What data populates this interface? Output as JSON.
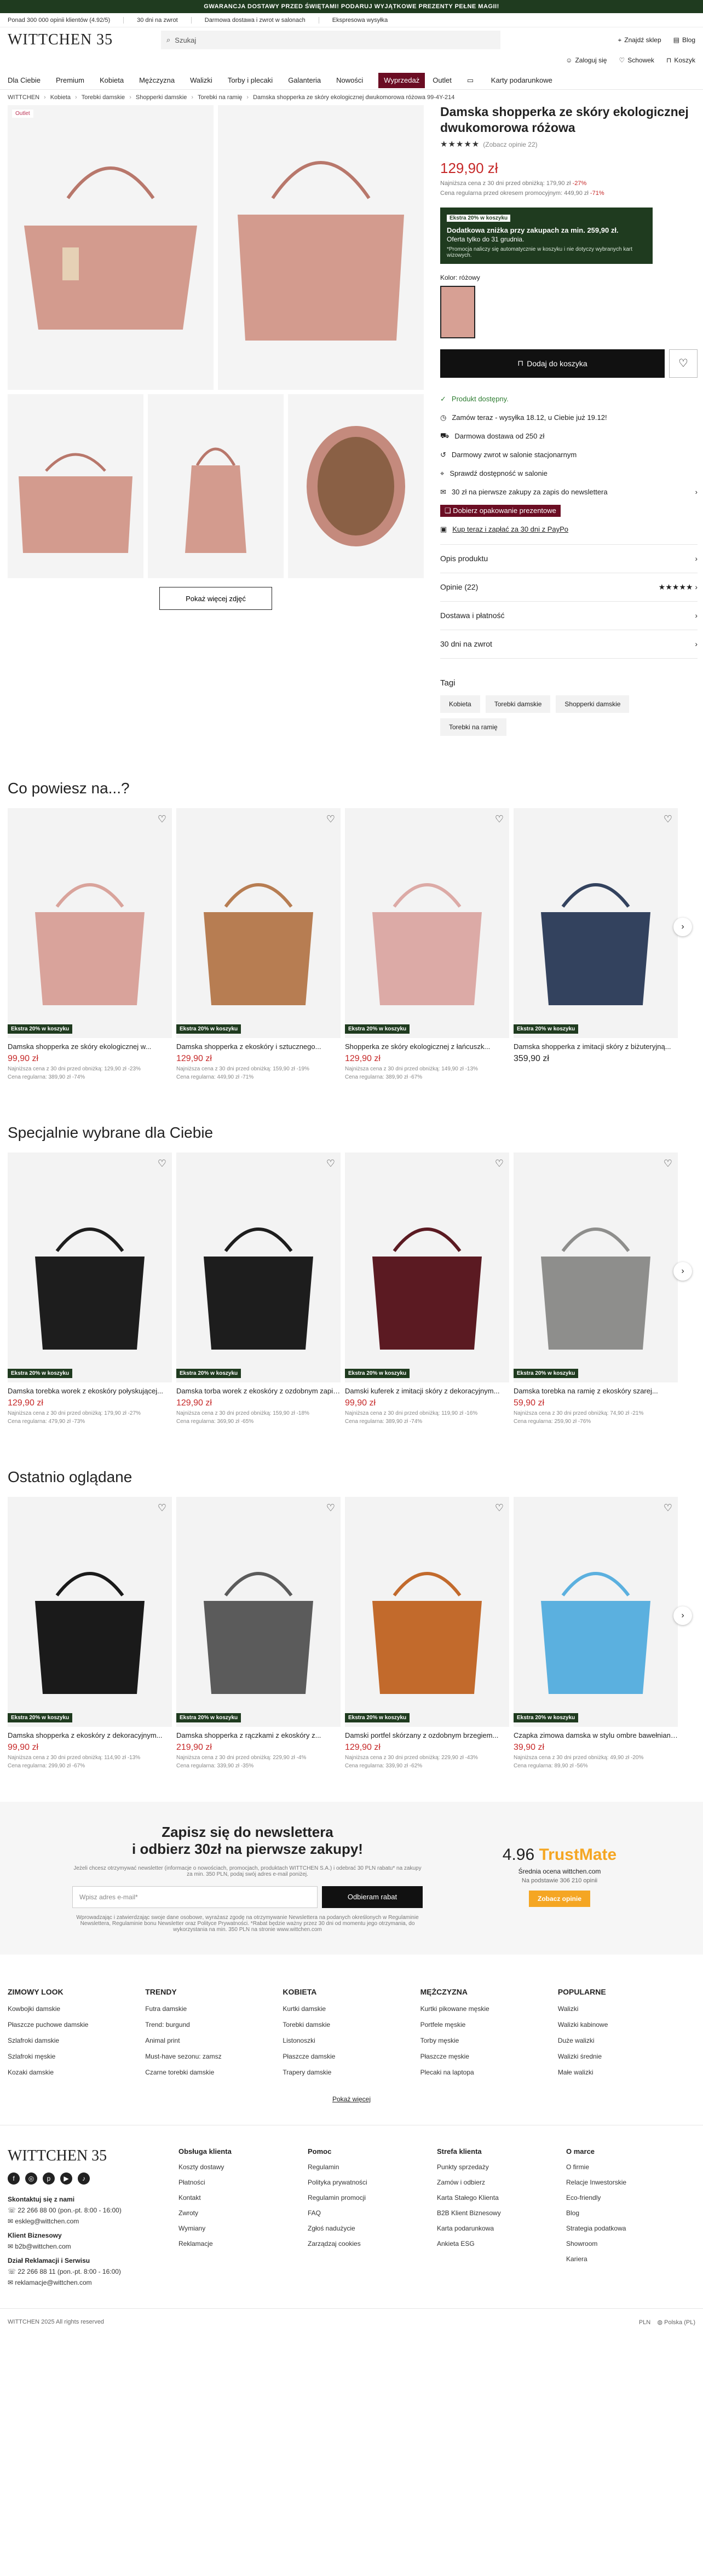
{
  "promo_bar": "GWARANCJA DOSTAWY PRZED ŚWIĘTAMI! PODARUJ WYJĄTKOWE PREZENTY PEŁNE MAGII!",
  "info_bar": [
    "Ponad 300 000 opinii klientów (4.92/5)",
    "30 dni na zwrot",
    "Darmowa dostawa i zwrot w salonach",
    "Ekspresowa wysyłka"
  ],
  "header": {
    "logo": "WITTCHEN 35",
    "search_placeholder": "Szukaj",
    "actions": [
      "Znajdź sklep",
      "Blog",
      "Zaloguj się",
      "Schowek",
      "Koszyk"
    ]
  },
  "nav": [
    "Dla Ciebie",
    "Premium",
    "Kobieta",
    "Mężczyzna",
    "Walizki",
    "Torby i plecaki",
    "Galanteria",
    "Nowości",
    "Wyprzedaż",
    "Outlet",
    "Karty podarunkowe"
  ],
  "breadcrumbs": [
    "WITTCHEN",
    "Kobieta",
    "Torebki damskie",
    "Shopperki damskie",
    "Torebki na ramię",
    "Damska shopperka ze skóry ekologicznej dwukomorowa różowa 99-4Y-214"
  ],
  "product": {
    "outlet_label": "Outlet",
    "title": "Damska shopperka ze skóry ekologicznej dwukomorowa różowa",
    "stars": "★★★★★",
    "reviews": "(Zobacz opinie 22)",
    "price": "129,90 zł",
    "lowest_30": "Najniższa cena z 30 dni przed obniżką: 179,90 zł",
    "lowest_30_pct": "-27%",
    "regular": "Cena regularna przed okresem promocyjnym: 449,90 zł",
    "regular_pct": "-71%",
    "promo_tag": "Ekstra 20% w koszyku",
    "promo_title": "Dodatkowa zniżka przy zakupach za min. 259,90 zł.",
    "promo_sub": "Oferta tylko do 31 grudnia.",
    "promo_note": "*Promocja naliczy się automatycznie w koszyku i nie dotyczy wybranych kart wizowych.",
    "color_label": "Kolor: różowy",
    "add_to_cart": "Dodaj do koszyka",
    "more_photos": "Pokaż więcej zdjęć",
    "features": [
      "Produkt dostępny.",
      "Zamów teraz - wysyłka 18.12, u Ciebie już 19.12!",
      "Darmowa dostawa od 250 zł",
      "Darmowy zwrot w salonie stacjonarnym",
      "Sprawdź dostępność w salonie",
      "30 zł na pierwsze zakupy za zapis do newslettera"
    ],
    "gift_wrap": "Dobierz opakowanie prezentowe",
    "paypo": "Kup teraz i zapłać za 30 dni z PayPo",
    "accordion": [
      "Opis produktu",
      "Opinie (22)",
      "Dostawa i płatność",
      "30 dni na zwrot"
    ],
    "tags_title": "Tagi",
    "tags": [
      "Kobieta",
      "Torebki damskie",
      "Shopperki damskie",
      "Torebki na ramię"
    ]
  },
  "sections": [
    {
      "title": "Co powiesz na...?",
      "items": [
        {
          "name": "Damska shopperka ze skóry ekologicznej w...",
          "price": "99,90 zł",
          "sm1": "Najniższa cena z 30 dni przed obniżką: 129,90 zł -23%",
          "sm2": "Cena regularna: 389,90 zł -74%",
          "badge": "Ekstra 20% w koszyku",
          "color": "#d9a39b"
        },
        {
          "name": "Damska shopperka z ekoskóry i sztucznego...",
          "price": "129,90 zł",
          "sm1": "Najniższa cena z 30 dni przed obniżką: 159,90 zł -19%",
          "sm2": "Cena regularna: 449,90 zł -71%",
          "badge": "Ekstra 20% w koszyku",
          "color": "#b77d52"
        },
        {
          "name": "Shopperka ze skóry ekologicznej z łańcuszk...",
          "price": "129,90 zł",
          "sm1": "Najniższa cena z 30 dni przed obniżką: 149,90 zł -13%",
          "sm2": "Cena regularna: 389,90 zł -67%",
          "badge": "Ekstra 20% w koszyku",
          "color": "#dcaaa6"
        },
        {
          "name": "Damska shopperka z imitacji skóry z biżuteryjną...",
          "price": "359,90 zł",
          "sm1": "",
          "sm2": "",
          "badge": "Ekstra 20% w koszyku",
          "color": "#33425e"
        }
      ]
    },
    {
      "title": "Specjalnie wybrane dla Ciebie",
      "items": [
        {
          "name": "Damska torebka worek z ekoskóry połyskującej...",
          "price": "129,90 zł",
          "sm1": "Najniższa cena z 30 dni przed obniżką: 179,90 zł -27%",
          "sm2": "Cena regularna: 479,90 zł -73%",
          "badge": "Ekstra 20% w koszyku",
          "color": "#1d1d1d"
        },
        {
          "name": "Damska torba worek z ekoskóry z ozdobnym zapięciem...",
          "price": "129,90 zł",
          "sm1": "Najniższa cena z 30 dni przed obniżką: 159,90 zł -18%",
          "sm2": "Cena regularna: 369,90 zł -65%",
          "badge": "Ekstra 20% w koszyku",
          "color": "#1d1d1d"
        },
        {
          "name": "Damski kuferek z imitacji skóry z dekoracyjnym...",
          "price": "99,90 zł",
          "sm1": "Najniższa cena z 30 dni przed obniżką: 119,90 zł -16%",
          "sm2": "Cena regularna: 389,90 zł -74%",
          "badge": "Ekstra 20% w koszyku",
          "color": "#5b1a22"
        },
        {
          "name": "Damska torebka na ramię z ekoskóry szarej...",
          "price": "59,90 zł",
          "sm1": "Najniższa cena z 30 dni przed obniżką: 74,90 zł -21%",
          "sm2": "Cena regularna: 259,90 zł -76%",
          "badge": "Ekstra 20% w koszyku",
          "color": "#8e8e8c"
        }
      ]
    },
    {
      "title": "Ostatnio oglądane",
      "items": [
        {
          "name": "Damska shopperka z ekoskóry z dekoracyjnym...",
          "price": "99,90 zł",
          "sm1": "Najniższa cena z 30 dni przed obniżką: 114,90 zł -13%",
          "sm2": "Cena regularna: 299,90 zł -67%",
          "badge": "Ekstra 20% w koszyku",
          "color": "#1a1a1a"
        },
        {
          "name": "Damska shopperka z rączkami z ekoskóry z...",
          "price": "219,90 zł",
          "sm1": "Najniższa cena z 30 dni przed obniżką: 229,90 zł -4%",
          "sm2": "Cena regularna: 339,90 zł -35%",
          "badge": "Ekstra 20% w koszyku",
          "color": "#5b5b5b"
        },
        {
          "name": "Damski portfel skórzany z ozdobnym brzegiem...",
          "price": "129,90 zł",
          "sm1": "Najniższa cena z 30 dni przed obniżką: 229,90 zł -43%",
          "sm2": "Cena regularna: 339,90 zł -62%",
          "badge": "Ekstra 20% w koszyku",
          "color": "#c26a2c"
        },
        {
          "name": "Czapka zimowa damska w stylu ombre bawełnianej...",
          "price": "39,90 zł",
          "sm1": "Najniższa cena z 30 dni przed obniżką: 49,90 zł -20%",
          "sm2": "Cena regularna: 89,90 zł -56%",
          "badge": "Ekstra 20% w koszyku",
          "color": "#5bb0df"
        }
      ]
    }
  ],
  "newsletter": {
    "title": "Zapisz się do newslettera\ni odbierz 30zł na pierwsze zakupy!",
    "desc": "Jeżeli chcesz otrzymywać newsletter (informacje o nowościach, promocjach, produktach WITTCHEN S.A.) i odebrać 30 PLN rabatu* na zakupy za min. 350 PLN, podaj swój adres e-mail poniżej.",
    "placeholder": "Wpisz adres e-mail*",
    "button": "Odbieram rabat",
    "legal": "Wprowadzając i zatwierdzając swoje dane osobowe, wyrażasz zgodę na otrzymywanie Newslettera na podanych określonych w Regulaminie Newslettera, Regulaminie bonu Newsletter oraz Polityce Prywatności. *Rabat będzie ważny przez 30 dni od momentu jego otrzymania, do wykorzystania na min. 350 PLN na stronie www.wittchen.com"
  },
  "trustmate": {
    "score": "4.96",
    "brand": "TrustMate",
    "avg": "Średnia ocena wittchen.com",
    "count": "Na podstawie 306 210 opinii",
    "button": "Zobacz opinie"
  },
  "link_cols": [
    {
      "title": "ZIMOWY LOOK",
      "items": [
        "Kowbojki damskie",
        "Płaszcze puchowe damskie",
        "Szlafroki damskie",
        "Szlafroki męskie",
        "Kozaki damskie"
      ]
    },
    {
      "title": "TRENDY",
      "items": [
        "Futra damskie",
        "Trend: burgund",
        "Animal print",
        "Must-have sezonu: zamsz",
        "Czarne torebki damskie"
      ]
    },
    {
      "title": "KOBIETA",
      "items": [
        "Kurtki damskie",
        "Torebki damskie",
        "Listonoszki",
        "Płaszcze damskie",
        "Trapery damskie"
      ]
    },
    {
      "title": "MĘŻCZYZNA",
      "items": [
        "Kurtki pikowane męskie",
        "Portfele męskie",
        "Torby męskie",
        "Płaszcze męskie",
        "Plecaki na laptopa"
      ]
    },
    {
      "title": "POPULARNE",
      "items": [
        "Walizki",
        "Walizki kabinowe",
        "Duże walizki",
        "Walizki średnie",
        "Małe walizki"
      ]
    }
  ],
  "all_categories": "Pokaż więcej",
  "footer": {
    "logo": "WITTCHEN 35",
    "contact_title": "Skontaktuj się z nami",
    "phone": "22 266 88 00 (pon.-pt. 8:00 - 16:00)",
    "email": "eskleg@wittchen.com",
    "biz_title": "Klient Biznesowy",
    "biz_email": "b2b@wittchen.com",
    "rekl_title": "Dział Reklamacji i Serwisu",
    "rekl_phone": "22 266 88 11 (pon.-pt. 8:00 - 16:00)",
    "rekl_email": "reklamacje@wittchen.com",
    "cols": [
      {
        "title": "Obsługa klienta",
        "items": [
          "Koszty dostawy",
          "Płatności",
          "Kontakt",
          "Zwroty",
          "Wymiany",
          "Reklamacje"
        ]
      },
      {
        "title": "Pomoc",
        "items": [
          "Regulamin",
          "Polityka prywatności",
          "Regulamin promocji",
          "FAQ",
          "Zgłoś nadużycie",
          "Zarządzaj cookies"
        ]
      },
      {
        "title": "Strefa klienta",
        "items": [
          "Punkty sprzedaży",
          "Zamów i odbierz",
          "Karta Stałego Klienta",
          "B2B Klient Biznesowy",
          "Karta podarunkowa",
          "Ankieta ESG"
        ]
      },
      {
        "title": "O marce",
        "items": [
          "O firmie",
          "Relacje Inwestorskie",
          "Eco-friendly",
          "Blog",
          "Strategia podatkowa",
          "Showroom",
          "Kariera"
        ]
      }
    ],
    "copyright": "WITTCHEN 2025 All rights reserved",
    "currency": "PLN",
    "country": "Polska (PL)"
  }
}
